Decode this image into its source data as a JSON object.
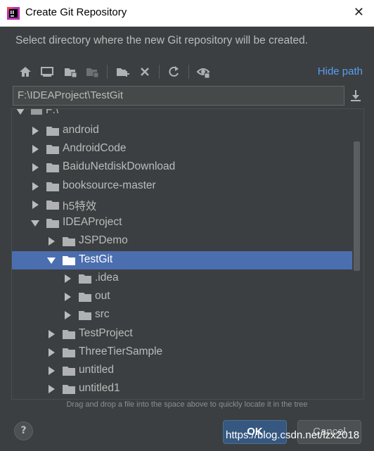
{
  "window": {
    "title": "Create Git Repository",
    "close_glyph": "✕"
  },
  "description": "Select directory where the new Git repository will be created.",
  "toolbar": {
    "icons": [
      "home-icon",
      "desktop-icon",
      "project-folder-icon",
      "module-folder-icon",
      "new-folder-icon",
      "delete-icon",
      "refresh-icon",
      "show-hidden-icon"
    ],
    "hide_path_label": "Hide path"
  },
  "path_input": {
    "value": "F:\\IDEAProject\\TestGit"
  },
  "tree": {
    "rows": [
      {
        "label": "F:\\",
        "expanded": true,
        "selected": false,
        "drive": true
      },
      {
        "label": "android",
        "expanded": false,
        "selected": false
      },
      {
        "label": "AndroidCode",
        "expanded": false,
        "selected": false
      },
      {
        "label": "BaiduNetdiskDownload",
        "expanded": false,
        "selected": false
      },
      {
        "label": "booksource-master",
        "expanded": false,
        "selected": false
      },
      {
        "label": "h5特效",
        "expanded": false,
        "selected": false
      },
      {
        "label": "IDEAProject",
        "expanded": true,
        "selected": false
      },
      {
        "label": "JSPDemo",
        "expanded": false,
        "selected": false
      },
      {
        "label": "TestGit",
        "expanded": true,
        "selected": true
      },
      {
        "label": ".idea",
        "expanded": false,
        "selected": false
      },
      {
        "label": "out",
        "expanded": false,
        "selected": false
      },
      {
        "label": "src",
        "expanded": false,
        "selected": false
      },
      {
        "label": "TestProject",
        "expanded": false,
        "selected": false
      },
      {
        "label": "ThreeTierSample",
        "expanded": false,
        "selected": false
      },
      {
        "label": "untitled",
        "expanded": false,
        "selected": false
      },
      {
        "label": "untitled1",
        "expanded": false,
        "selected": false
      }
    ]
  },
  "hint": "Drag and drop a file into the space above to quickly locate it in the tree",
  "buttons": {
    "help": "?",
    "ok": "OK",
    "cancel": "Cancel"
  },
  "watermark": "https://blog.csdn.net/lzx2018",
  "colors": {
    "background": "#3c3f41",
    "selection": "#4b6eaf",
    "link": "#589df6",
    "ok_button": "#365880"
  }
}
